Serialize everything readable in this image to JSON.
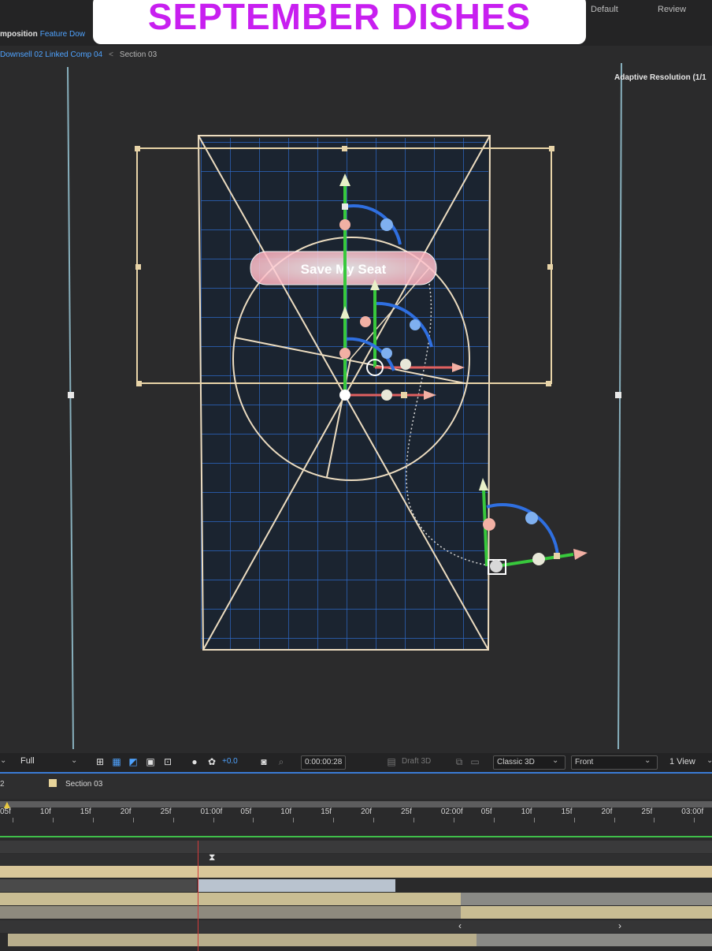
{
  "overlay_title": "SEPTEMBER DISHES",
  "workspaces": [
    "Default",
    "Review"
  ],
  "composition": {
    "label": "mposition",
    "name": "Feature Dow"
  },
  "breadcrumb": {
    "parent": "Downsell 02 Linked Comp 04",
    "separator": "<",
    "current": "Section 03"
  },
  "adaptive_resolution": "Adaptive Resolution (1/1",
  "canvas_button_text": "Save My Seat",
  "toolbar": {
    "resolution": "Full",
    "exposure": "+0.0",
    "timecode": "0:00:00:28",
    "draft3d": "Draft 3D",
    "renderer": "Classic 3D",
    "view": "Front",
    "views": "1 View"
  },
  "timeline": {
    "tab_prefix": "2",
    "tab_name": "Section 03",
    "tab_color": "#e8d49a",
    "ruler_labels": [
      "05f",
      "10f",
      "15f",
      "20f",
      "25f",
      "01:00f",
      "05f",
      "10f",
      "15f",
      "20f",
      "25f",
      "02:00f",
      "05f",
      "10f",
      "15f",
      "20f",
      "25f",
      "03:00f"
    ]
  },
  "colors": {
    "accent": "#c81ff0",
    "link": "#4fa3ff",
    "guide": "#e8d4a8",
    "grid": "#2f6fd6",
    "playhead": "#d23b3b"
  },
  "icons": [
    "grid-icon",
    "mask-icon",
    "camera-icon",
    "color-wheel-icon",
    "transparency-icon",
    "snapshot-icon",
    "render-icon"
  ]
}
